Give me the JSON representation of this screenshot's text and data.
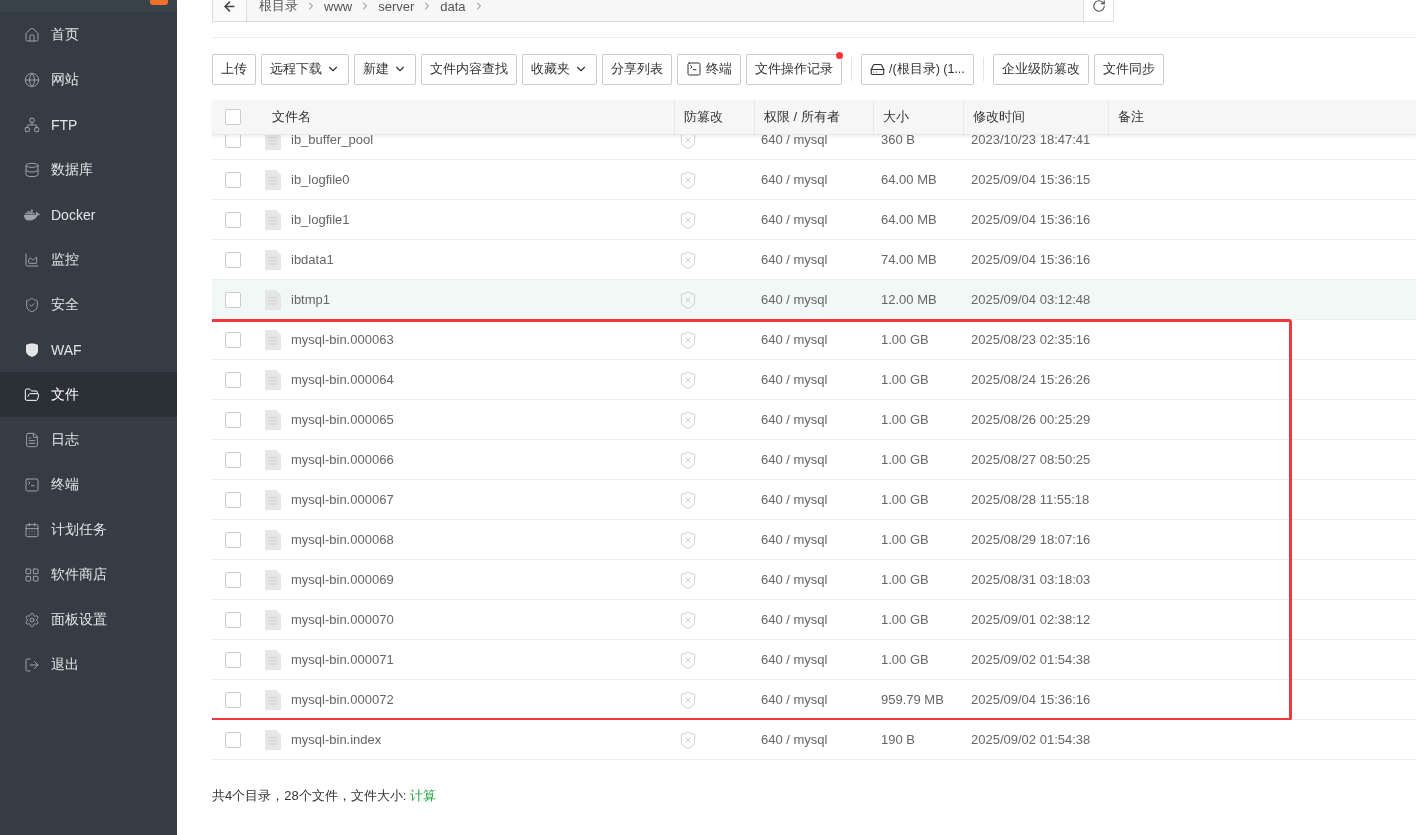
{
  "sidebar": {
    "items": [
      {
        "label": "首页",
        "selected": false
      },
      {
        "label": "网站",
        "selected": false
      },
      {
        "label": "FTP",
        "selected": false
      },
      {
        "label": "数据库",
        "selected": false
      },
      {
        "label": "Docker",
        "selected": false
      },
      {
        "label": "监控",
        "selected": false
      },
      {
        "label": "安全",
        "selected": false
      },
      {
        "label": "WAF",
        "selected": false
      },
      {
        "label": "文件",
        "selected": true
      },
      {
        "label": "日志",
        "selected": false
      },
      {
        "label": "终端",
        "selected": false
      },
      {
        "label": "计划任务",
        "selected": false
      },
      {
        "label": "软件商店",
        "selected": false
      },
      {
        "label": "面板设置",
        "selected": false
      },
      {
        "label": "退出",
        "selected": false
      }
    ]
  },
  "breadcrumb": [
    "根目录",
    "www",
    "server",
    "data"
  ],
  "toolbar": [
    {
      "label": "上传",
      "kind": "plain",
      "dot": false
    },
    {
      "label": "远程下载",
      "kind": "dropdown",
      "dot": false
    },
    {
      "label": "新建",
      "kind": "dropdown",
      "dot": false
    },
    {
      "label": "文件内容查找",
      "kind": "plain",
      "dot": false
    },
    {
      "label": "收藏夹",
      "kind": "dropdown",
      "dot": false
    },
    {
      "label": "分享列表",
      "kind": "plain",
      "dot": false
    },
    {
      "label": "终端",
      "kind": "terminal",
      "dot": false
    },
    {
      "label": "文件操作记录",
      "kind": "plain",
      "dot": true
    },
    {
      "kind": "separator"
    },
    {
      "label": "/(根目录) (1...",
      "kind": "disk",
      "dot": false
    },
    {
      "kind": "separator"
    },
    {
      "label": "企业级防篡改",
      "kind": "plain",
      "dot": false
    },
    {
      "label": "文件同步",
      "kind": "plain",
      "dot": false
    }
  ],
  "table": {
    "select_all": {
      "checked": false
    },
    "columns": [
      "文件名",
      "防篡改",
      "权限 / 所有者",
      "大小",
      "修改时间",
      "备注"
    ],
    "row_groups": [
      {
        "framed": false,
        "rows": [
          {
            "name": "ib_buffer_pool",
            "perm": "640 / mysql",
            "size": "360 B",
            "mtime": "2023/10/23 18:47:41",
            "checked": false,
            "hovered": false
          },
          {
            "name": "ib_logfile0",
            "perm": "640 / mysql",
            "size": "64.00 MB",
            "mtime": "2025/09/04 15:36:15",
            "checked": false,
            "hovered": false
          },
          {
            "name": "ib_logfile1",
            "perm": "640 / mysql",
            "size": "64.00 MB",
            "mtime": "2025/09/04 15:36:16",
            "checked": false,
            "hovered": false
          },
          {
            "name": "ibdata1",
            "perm": "640 / mysql",
            "size": "74.00 MB",
            "mtime": "2025/09/04 15:36:16",
            "checked": false,
            "hovered": false
          },
          {
            "name": "ibtmp1",
            "perm": "640 / mysql",
            "size": "12.00 MB",
            "mtime": "2025/09/04 03:12:48",
            "checked": false,
            "hovered": true
          }
        ]
      },
      {
        "framed": true,
        "rows": [
          {
            "name": "mysql-bin.000063",
            "perm": "640 / mysql",
            "size": "1.00 GB",
            "mtime": "2025/08/23 02:35:16",
            "checked": false,
            "hovered": false
          },
          {
            "name": "mysql-bin.000064",
            "perm": "640 / mysql",
            "size": "1.00 GB",
            "mtime": "2025/08/24 15:26:26",
            "checked": false,
            "hovered": false
          },
          {
            "name": "mysql-bin.000065",
            "perm": "640 / mysql",
            "size": "1.00 GB",
            "mtime": "2025/08/26 00:25:29",
            "checked": false,
            "hovered": false
          },
          {
            "name": "mysql-bin.000066",
            "perm": "640 / mysql",
            "size": "1.00 GB",
            "mtime": "2025/08/27 08:50:25",
            "checked": false,
            "hovered": false
          },
          {
            "name": "mysql-bin.000067",
            "perm": "640 / mysql",
            "size": "1.00 GB",
            "mtime": "2025/08/28 11:55:18",
            "checked": false,
            "hovered": false
          },
          {
            "name": "mysql-bin.000068",
            "perm": "640 / mysql",
            "size": "1.00 GB",
            "mtime": "2025/08/29 18:07:16",
            "checked": false,
            "hovered": false
          },
          {
            "name": "mysql-bin.000069",
            "perm": "640 / mysql",
            "size": "1.00 GB",
            "mtime": "2025/08/31 03:18:03",
            "checked": false,
            "hovered": false
          },
          {
            "name": "mysql-bin.000070",
            "perm": "640 / mysql",
            "size": "1.00 GB",
            "mtime": "2025/09/01 02:38:12",
            "checked": false,
            "hovered": false
          },
          {
            "name": "mysql-bin.000071",
            "perm": "640 / mysql",
            "size": "1.00 GB",
            "mtime": "2025/09/02 01:54:38",
            "checked": false,
            "hovered": false
          },
          {
            "name": "mysql-bin.000072",
            "perm": "640 / mysql",
            "size": "959.79 MB",
            "mtime": "2025/09/04 15:36:16",
            "checked": false,
            "hovered": false
          }
        ]
      },
      {
        "framed": false,
        "rows": [
          {
            "name": "mysql-bin.index",
            "perm": "640 / mysql",
            "size": "190 B",
            "mtime": "2025/09/02 01:54:38",
            "checked": false,
            "hovered": false
          }
        ]
      }
    ]
  },
  "footer": {
    "summary": "共4个目录，28个文件，文件大小:",
    "link": "计算"
  }
}
